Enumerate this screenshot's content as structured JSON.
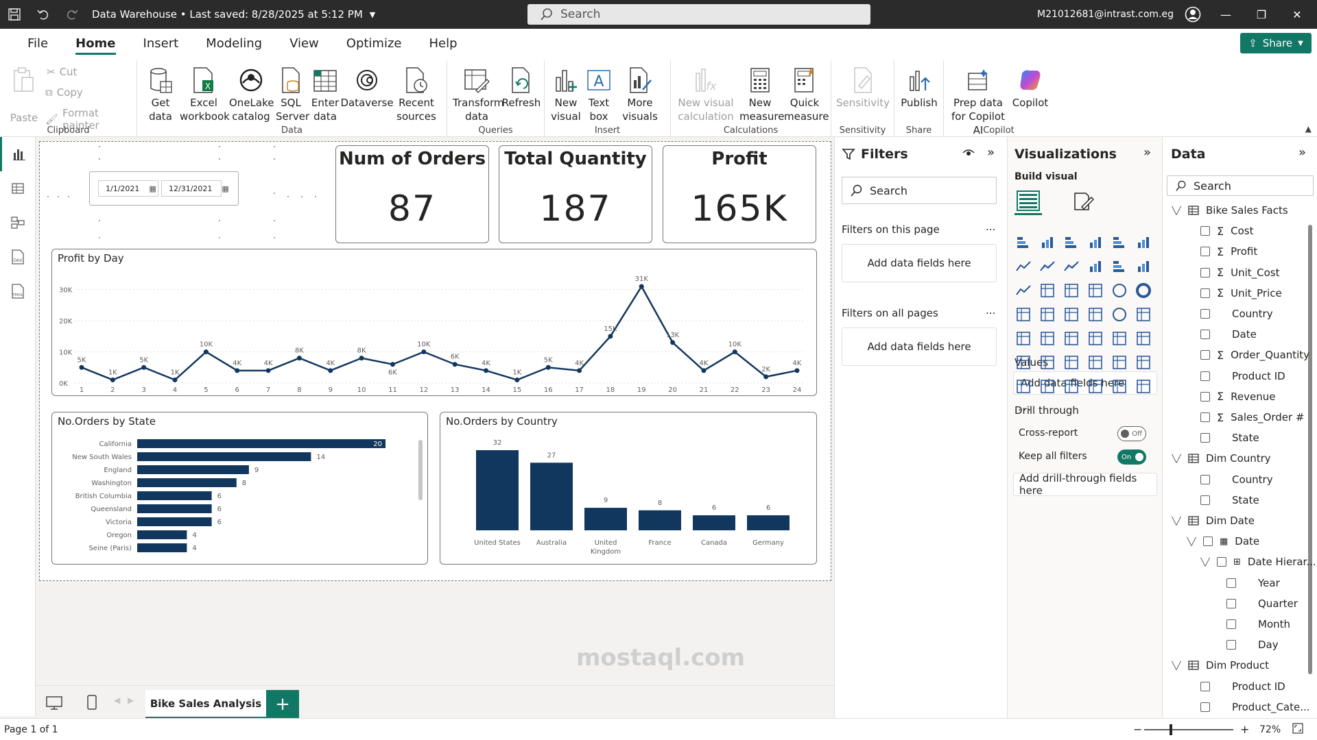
{
  "titlebar": {
    "doc_title": "Data Warehouse • Last saved: 8/28/2025 at 5:12 PM",
    "search_placeholder": "Search",
    "user": "M21012681@intrast.com.eg"
  },
  "menu": {
    "items": [
      "File",
      "Home",
      "Insert",
      "Modeling",
      "View",
      "Optimize",
      "Help"
    ],
    "active": "Home",
    "share_label": "Share"
  },
  "ribbon": {
    "clipboard": {
      "paste": "Paste",
      "cut": "Cut",
      "copy": "Copy",
      "format_painter": "Format painter",
      "label": "Clipboard"
    },
    "data": {
      "get_data": "Get data",
      "excel": "Excel workbook",
      "onelake": "OneLake catalog",
      "sql": "SQL Server",
      "enter": "Enter data",
      "dataverse": "Dataverse",
      "recent": "Recent sources",
      "label": "Data"
    },
    "queries": {
      "transform": "Transform data",
      "refresh": "Refresh",
      "label": "Queries"
    },
    "insert": {
      "new_visual": "New visual",
      "text_box": "Text box",
      "more_visuals": "More visuals",
      "label": "Insert"
    },
    "calculations": {
      "new_visual_calc": "New visual calculation",
      "new_measure": "New measure",
      "quick_measure": "Quick measure",
      "label": "Calculations"
    },
    "sensitivity": {
      "sensitivity": "Sensitivity",
      "label": "Sensitivity"
    },
    "share": {
      "publish": "Publish",
      "label": "Share"
    },
    "copilot": {
      "prep": "Prep data for Copilot AI",
      "copilot": "Copilot",
      "label": "Copilot"
    }
  },
  "slicer": {
    "start": "1/1/2021",
    "end": "12/31/2021"
  },
  "cards": [
    {
      "title": "Num of Orders",
      "value": "87"
    },
    {
      "title": "Total Quantity",
      "value": "187"
    },
    {
      "title": "Profit",
      "value": "165K"
    }
  ],
  "chart_data": [
    {
      "type": "line",
      "title": "Profit by Day",
      "x": [
        1,
        2,
        3,
        4,
        5,
        6,
        7,
        8,
        9,
        10,
        11,
        12,
        13,
        14,
        15,
        16,
        17,
        18,
        19,
        20,
        21,
        22,
        23,
        24
      ],
      "values": [
        5000,
        1000,
        5000,
        1000,
        10000,
        4000,
        4000,
        8000,
        4000,
        8000,
        6000,
        10000,
        6000,
        4000,
        1000,
        5000,
        4000,
        15000,
        31000,
        13000,
        4000,
        10000,
        2000,
        4000
      ],
      "data_labels": [
        "5K",
        "1K",
        "5K",
        "1K",
        "10K",
        "4K",
        "4K",
        "8K",
        "4K",
        "8K",
        "6K",
        "10K",
        "6K",
        "4K",
        "1K",
        "5K",
        "4K",
        "15K",
        "31K",
        "13K",
        "4K",
        "10K",
        "2K",
        "4K"
      ],
      "y_ticks": [
        "0K",
        "10K",
        "20K",
        "30K"
      ],
      "ylim": [
        0,
        33000
      ],
      "color": "#12375e"
    },
    {
      "type": "bar",
      "orientation": "horizontal",
      "title": "No.Orders by State",
      "categories": [
        "California",
        "New South Wales",
        "England",
        "Washington",
        "British Columbia",
        "Queensland",
        "Victoria",
        "Oregon",
        "Seine (Paris)"
      ],
      "values": [
        20,
        14,
        9,
        8,
        6,
        6,
        6,
        4,
        4
      ],
      "xlim": [
        0,
        20
      ],
      "color": "#12375e"
    },
    {
      "type": "bar",
      "orientation": "vertical",
      "title": "No.Orders by Country",
      "categories": [
        "United States",
        "Australia",
        "United Kingdom",
        "France",
        "Canada",
        "Germany"
      ],
      "values": [
        32,
        27,
        9,
        8,
        6,
        6
      ],
      "ylim": [
        0,
        32
      ],
      "color": "#12375e"
    }
  ],
  "page_tabs": {
    "active": "Bike Sales Analysis",
    "add": "+"
  },
  "status": {
    "page": "Page 1 of 1",
    "zoom": "72%"
  },
  "filters": {
    "title": "Filters",
    "search": "Search",
    "this_page": "Filters on this page",
    "all_pages": "Filters on all pages",
    "add_fields": "Add data fields here",
    "more": "..."
  },
  "visualizations": {
    "title": "Visualizations",
    "build": "Build visual",
    "values": "Values",
    "add_fields": "Add data fields here",
    "drill": "Drill through",
    "cross_report": "Cross-report",
    "cross_state": "Off",
    "keep_filters": "Keep all filters",
    "keep_state": "On",
    "add_drill": "Add drill-through fields here",
    "more": "..."
  },
  "data_pane": {
    "title": "Data",
    "search": "Search",
    "tree": [
      {
        "level": 0,
        "kind": "table",
        "label": "Bike Sales Facts"
      },
      {
        "level": 1,
        "kind": "measure",
        "label": "Cost"
      },
      {
        "level": 1,
        "kind": "measure",
        "label": "Profit"
      },
      {
        "level": 1,
        "kind": "measure",
        "label": "Unit_Cost"
      },
      {
        "level": 1,
        "kind": "measure",
        "label": "Unit_Price"
      },
      {
        "level": 1,
        "kind": "field",
        "label": "Country"
      },
      {
        "level": 1,
        "kind": "field",
        "label": "Date"
      },
      {
        "level": 1,
        "kind": "measure",
        "label": "Order_Quantity"
      },
      {
        "level": 1,
        "kind": "field",
        "label": "Product ID"
      },
      {
        "level": 1,
        "kind": "measure",
        "label": "Revenue"
      },
      {
        "level": 1,
        "kind": "measure",
        "label": "Sales_Order #"
      },
      {
        "level": 1,
        "kind": "field",
        "label": "State"
      },
      {
        "level": 0,
        "kind": "table",
        "label": "Dim Country"
      },
      {
        "level": 1,
        "kind": "field",
        "label": "Country"
      },
      {
        "level": 1,
        "kind": "field",
        "label": "State"
      },
      {
        "level": 0,
        "kind": "table",
        "label": "Dim Date"
      },
      {
        "level": 1,
        "kind": "date",
        "label": "Date"
      },
      {
        "level": 2,
        "kind": "hierarchy",
        "label": "Date Hierar..."
      },
      {
        "level": 3,
        "kind": "field",
        "label": "Year"
      },
      {
        "level": 3,
        "kind": "field",
        "label": "Quarter"
      },
      {
        "level": 3,
        "kind": "field",
        "label": "Month"
      },
      {
        "level": 3,
        "kind": "field",
        "label": "Day"
      },
      {
        "level": 0,
        "kind": "table",
        "label": "Dim Product"
      },
      {
        "level": 1,
        "kind": "field",
        "label": "Product ID"
      },
      {
        "level": 1,
        "kind": "field",
        "label": "Product_Cate..."
      }
    ]
  },
  "watermark": "mostaql.com",
  "colors": {
    "accent": "#117865",
    "bar": "#12375e",
    "titlebar": "#2b2b2b"
  }
}
